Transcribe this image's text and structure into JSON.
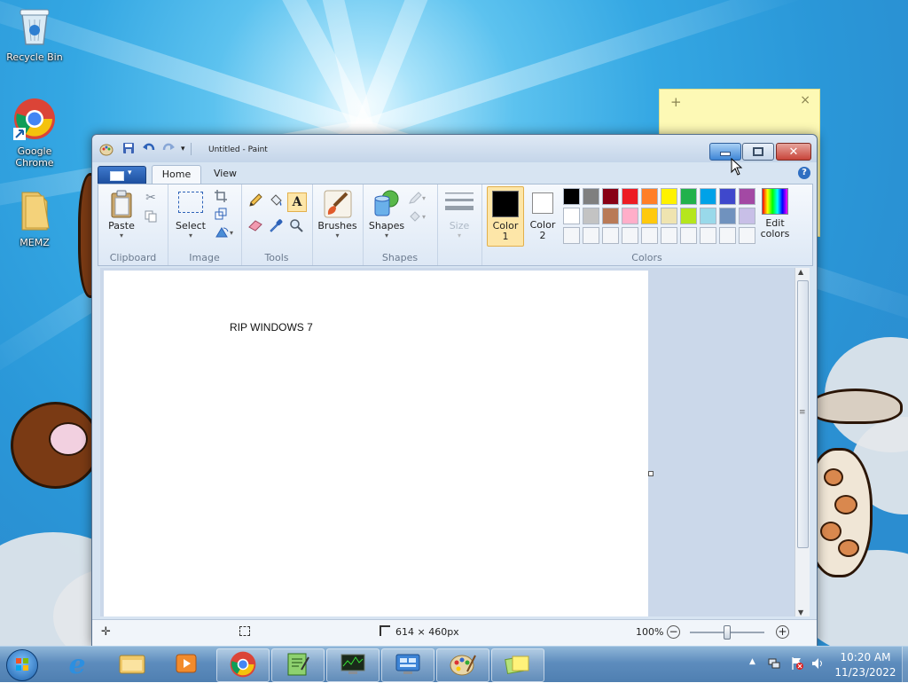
{
  "desktop": {
    "icons": [
      {
        "label": "Recycle Bin",
        "icon": "recycle-bin-icon"
      },
      {
        "label": "Google Chrome",
        "icon": "chrome-icon"
      },
      {
        "label": "MEMZ",
        "icon": "folder-icon"
      }
    ]
  },
  "sticky_note": {
    "plus": "+",
    "close": "×"
  },
  "paint": {
    "title": "Untitled - Paint",
    "tabs": [
      {
        "label": "Home",
        "active": true
      },
      {
        "label": "View",
        "active": false
      }
    ],
    "groups": {
      "clipboard": {
        "label": "Clipboard",
        "paste": "Paste"
      },
      "image": {
        "label": "Image",
        "select": "Select"
      },
      "tools": {
        "label": "Tools"
      },
      "brushes": "Brushes",
      "shapes": {
        "label": "Shapes",
        "button": "Shapes"
      },
      "size": "Size",
      "colors": {
        "label": "Colors",
        "color1": "Color 1",
        "color2": "Color 2",
        "edit": "Edit colors",
        "color1_value": "#000000",
        "color2_value": "#ffffff",
        "palette_row1": [
          "#000000",
          "#7f7f7f",
          "#880015",
          "#ed1c24",
          "#ff7f27",
          "#fff200",
          "#22b14c",
          "#00a2e8",
          "#3f48cc",
          "#a349a4"
        ],
        "palette_row2": [
          "#ffffff",
          "#c3c3c3",
          "#b97a57",
          "#ffaec9",
          "#ffc90e",
          "#efe4b0",
          "#b5e61d",
          "#99d9ea",
          "#7092be",
          "#c8bfe7"
        ]
      }
    },
    "canvas_text": "RIP WINDOWS 7",
    "status": {
      "image_size": "614 × 460px",
      "zoom": "100%"
    }
  },
  "taskbar": {
    "clock_time": "10:20 AM",
    "clock_date": "11/23/2022"
  },
  "accent_colors": {
    "taskbar": "#5d8cbd",
    "close_button": "#c8443a",
    "sticky": "#fdf9b5"
  }
}
